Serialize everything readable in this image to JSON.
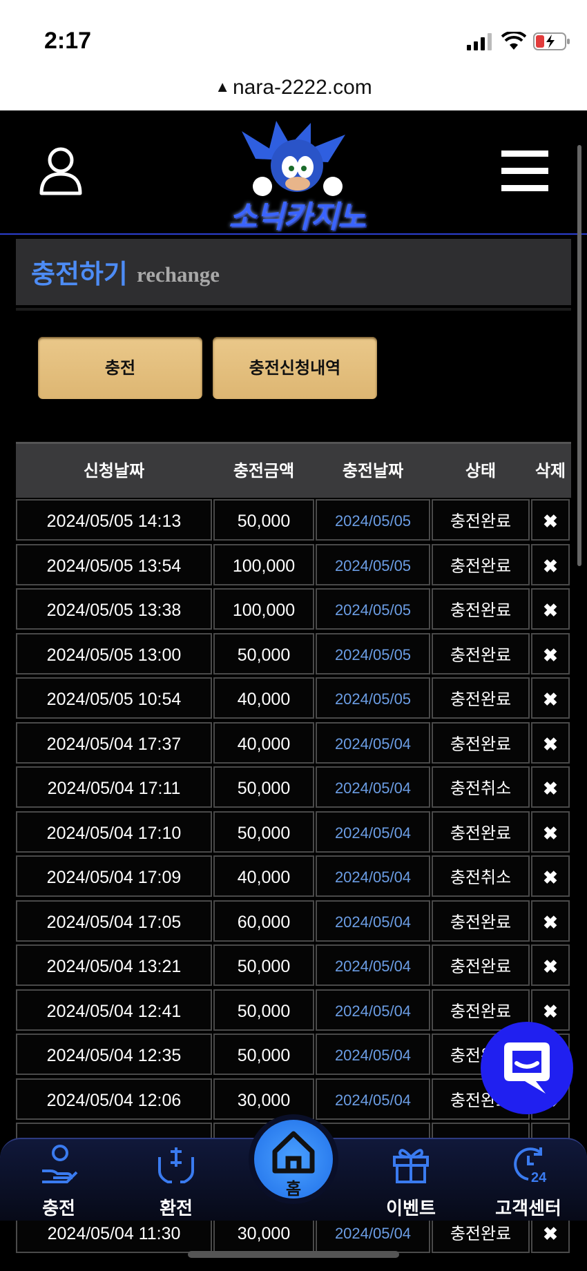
{
  "status": {
    "time": "2:17",
    "url": "nara-2222.com"
  },
  "header": {
    "logo_text": "소닉카지노"
  },
  "section": {
    "title_ko": "충전하기",
    "title_en": "rechange"
  },
  "buttons": {
    "charge": "충전",
    "history": "충전신청내역"
  },
  "table": {
    "headers": [
      "신청날짜",
      "충전금액",
      "충전날짜",
      "상태",
      "삭제"
    ],
    "delete_symbol": "✖",
    "rows": [
      {
        "req": "2024/05/05 14:13",
        "amount": "50,000",
        "date": "2024/05/05",
        "status": "충전완료"
      },
      {
        "req": "2024/05/05 13:54",
        "amount": "100,000",
        "date": "2024/05/05",
        "status": "충전완료"
      },
      {
        "req": "2024/05/05 13:38",
        "amount": "100,000",
        "date": "2024/05/05",
        "status": "충전완료"
      },
      {
        "req": "2024/05/05 13:00",
        "amount": "50,000",
        "date": "2024/05/05",
        "status": "충전완료"
      },
      {
        "req": "2024/05/05 10:54",
        "amount": "40,000",
        "date": "2024/05/05",
        "status": "충전완료"
      },
      {
        "req": "2024/05/04 17:37",
        "amount": "40,000",
        "date": "2024/05/04",
        "status": "충전완료"
      },
      {
        "req": "2024/05/04 17:11",
        "amount": "50,000",
        "date": "2024/05/04",
        "status": "충전취소"
      },
      {
        "req": "2024/05/04 17:10",
        "amount": "50,000",
        "date": "2024/05/04",
        "status": "충전완료"
      },
      {
        "req": "2024/05/04 17:09",
        "amount": "40,000",
        "date": "2024/05/04",
        "status": "충전취소"
      },
      {
        "req": "2024/05/04 17:05",
        "amount": "60,000",
        "date": "2024/05/04",
        "status": "충전완료"
      },
      {
        "req": "2024/05/04 13:21",
        "amount": "50,000",
        "date": "2024/05/04",
        "status": "충전완료"
      },
      {
        "req": "2024/05/04 12:41",
        "amount": "50,000",
        "date": "2024/05/04",
        "status": "충전완료"
      },
      {
        "req": "2024/05/04 12:35",
        "amount": "50,000",
        "date": "2024/05/04",
        "status": "충전완료"
      },
      {
        "req": "2024/05/04 12:06",
        "amount": "30,000",
        "date": "2024/05/04",
        "status": "충전완료"
      },
      {
        "req": "",
        "amount": "",
        "date": "",
        "status": ""
      },
      {
        "req": "",
        "amount": "",
        "date": "",
        "status": ""
      },
      {
        "req": "2024/05/04 11:30",
        "amount": "30,000",
        "date": "2024/05/04",
        "status": "충전완료"
      }
    ]
  },
  "nav": {
    "charge": "충전",
    "exchange": "환전",
    "home": "홈",
    "event": "이벤트",
    "support": "고객센터"
  },
  "colors": {
    "accent": "#4d8cf5",
    "gold": "#e6c283",
    "chat": "#2020f0"
  }
}
